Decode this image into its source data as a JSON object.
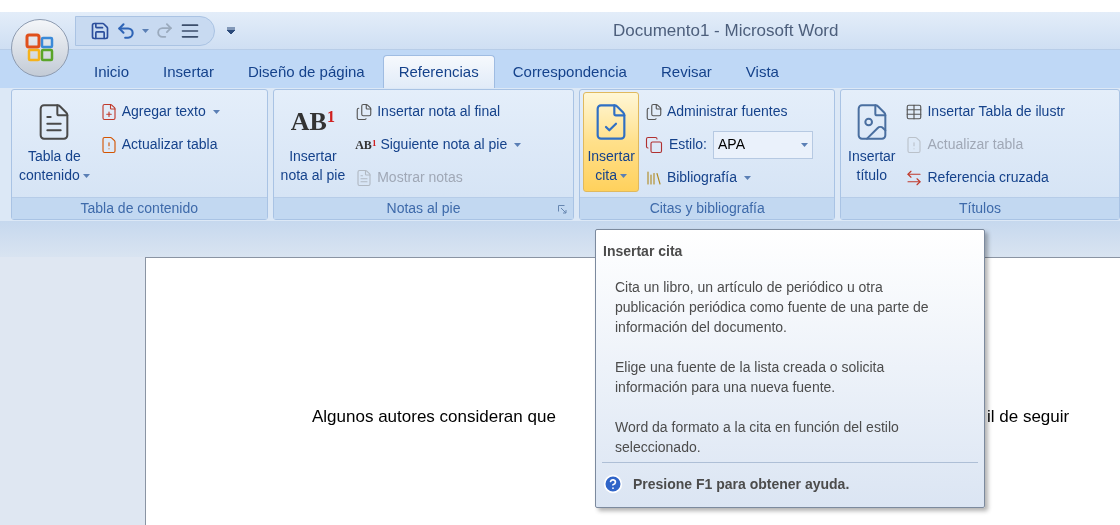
{
  "window": {
    "title": "Documento1 - Microsoft Word"
  },
  "tabs": [
    {
      "label": "Inicio",
      "selected": false
    },
    {
      "label": "Insertar",
      "selected": false
    },
    {
      "label": "Diseño de página",
      "selected": false
    },
    {
      "label": "Referencias",
      "selected": true
    },
    {
      "label": "Correspondencia",
      "selected": false
    },
    {
      "label": "Revisar",
      "selected": false
    },
    {
      "label": "Vista",
      "selected": false
    }
  ],
  "ribbon": {
    "groups": [
      {
        "label": "Tabla de contenido",
        "launcher": false,
        "large": {
          "label_lines": [
            "Tabla de",
            "contenido"
          ],
          "caret": true,
          "highlighted": false
        },
        "items": [
          {
            "kind": "button",
            "label": "Agregar texto",
            "caret": true,
            "disabled": false
          },
          {
            "kind": "button",
            "label": "Actualizar tabla",
            "caret": false,
            "disabled": false
          }
        ]
      },
      {
        "label": "Notas al pie",
        "launcher": true,
        "large": {
          "label_lines": [
            "Insertar",
            "nota al pie"
          ],
          "caret": false,
          "highlighted": false,
          "icon_text": "AB",
          "icon_sup": "1"
        },
        "items": [
          {
            "kind": "button",
            "label": "Insertar nota al final",
            "caret": false,
            "disabled": false
          },
          {
            "kind": "button",
            "label": "Siguiente nota al pie",
            "caret": true,
            "disabled": false,
            "icon_text": "AB",
            "icon_sup": "1"
          },
          {
            "kind": "button",
            "label": "Mostrar notas",
            "caret": false,
            "disabled": true
          }
        ]
      },
      {
        "label": "Citas y bibliografía",
        "launcher": false,
        "large": {
          "label_lines": [
            "Insertar",
            "cita"
          ],
          "caret": true,
          "highlighted": true
        },
        "items": [
          {
            "kind": "button",
            "label": "Administrar fuentes",
            "caret": false,
            "disabled": false
          },
          {
            "kind": "combo",
            "label": "Estilo:",
            "value": "APA"
          },
          {
            "kind": "button",
            "label": "Bibliografía",
            "caret": true,
            "disabled": false
          }
        ]
      },
      {
        "label": "Títulos",
        "launcher": false,
        "large": {
          "label_lines": [
            "Insertar",
            "título"
          ],
          "caret": false,
          "highlighted": false
        },
        "items": [
          {
            "kind": "button",
            "label": "Insertar Tabla de ilustr",
            "caret": false,
            "disabled": false
          },
          {
            "kind": "button",
            "label": "Actualizar tabla",
            "caret": false,
            "disabled": true
          },
          {
            "kind": "button",
            "label": "Referencia cruzada",
            "caret": false,
            "disabled": false
          }
        ]
      }
    ]
  },
  "document": {
    "text_left": "Algunos autores consideran que",
    "text_right": "il de seguir"
  },
  "tooltip": {
    "title": "Insertar cita",
    "paragraphs": [
      "Cita un libro, un artículo de periódico u otra publicación periódica como fuente de una parte de información del documento.",
      "Elige una fuente de la lista creada o solicita información para una nueva fuente.",
      "Word da formato a la cita en función del estilo seleccionado."
    ],
    "help": "Presione F1 para obtener ayuda."
  }
}
